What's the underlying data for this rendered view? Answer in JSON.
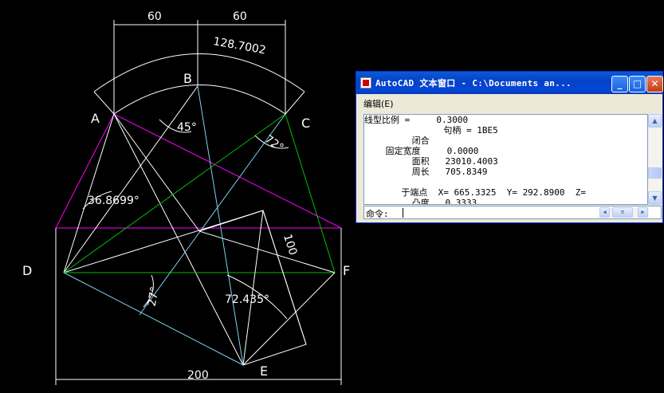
{
  "drawing": {
    "points": {
      "A": "A",
      "B": "B",
      "C": "C",
      "D": "D",
      "E": "E",
      "F": "F"
    },
    "dims": {
      "top_left": "60",
      "top_right": "60",
      "arc_length": "128.7002",
      "bottom": "200",
      "side": "100"
    },
    "angles": {
      "a45": "45°",
      "a72": "72°",
      "a36": "36.8699°",
      "a27": "27°",
      "a72435": "72.435°"
    }
  },
  "text_window": {
    "title": "AutoCAD 文本窗口 - C:\\Documents an...",
    "menu_edit": "编辑(E)",
    "lines": [
      "线型比例 =     0.3000",
      "               句柄 = 1BE5",
      "         闭合",
      "    固定宽度     0.0000",
      "         面积   23010.4003",
      "         周长   705.8349",
      "",
      "       于端点  X= 665.3325  Y= 292.8900  Z=",
      "         凸度   0.3333"
    ],
    "command_label": "命令:"
  },
  "colors": {
    "background": "#000000",
    "white_line": "#ffffff",
    "magenta": "#ff00ff",
    "green": "#00c000",
    "cyan": "#7fd0f0",
    "titlebar": "#0642c6"
  }
}
